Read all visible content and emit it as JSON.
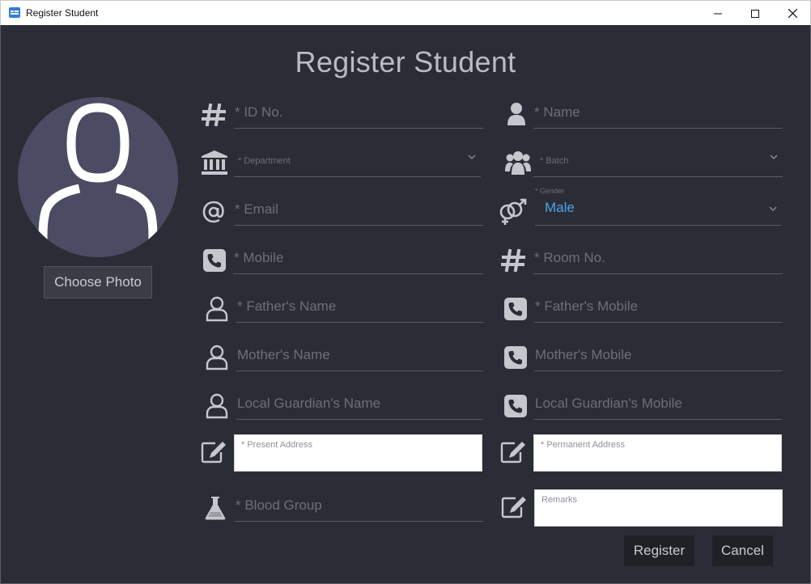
{
  "window": {
    "title": "Register Student"
  },
  "heading": "Register Student",
  "photo": {
    "choose_label": "Choose Photo"
  },
  "fields": {
    "id_no": "* ID No.",
    "name": "* Name",
    "department": "* Department",
    "batch": "* Batch",
    "email": "* Email",
    "gender_label": "* Gender",
    "gender_value": "Male",
    "mobile": "* Mobile",
    "room_no": "* Room No.",
    "fathers_name": "* Father's Name",
    "fathers_mobile": "* Father's Mobile",
    "mothers_name": "Mother's Name",
    "mothers_mobile": "Mother's Mobile",
    "guardian_name": "Local Guardian's Name",
    "guardian_mobile": "Local Guardian's Mobile",
    "present_address": "* Present Address",
    "permanent_address": "* Permanent Address",
    "blood_group": "* Blood Group",
    "remarks": "Remarks"
  },
  "actions": {
    "register": "Register",
    "cancel": "Cancel"
  },
  "colors": {
    "background": "#2a2d35",
    "accent": "#4aa3f0",
    "icon": "#c5c7cc"
  }
}
